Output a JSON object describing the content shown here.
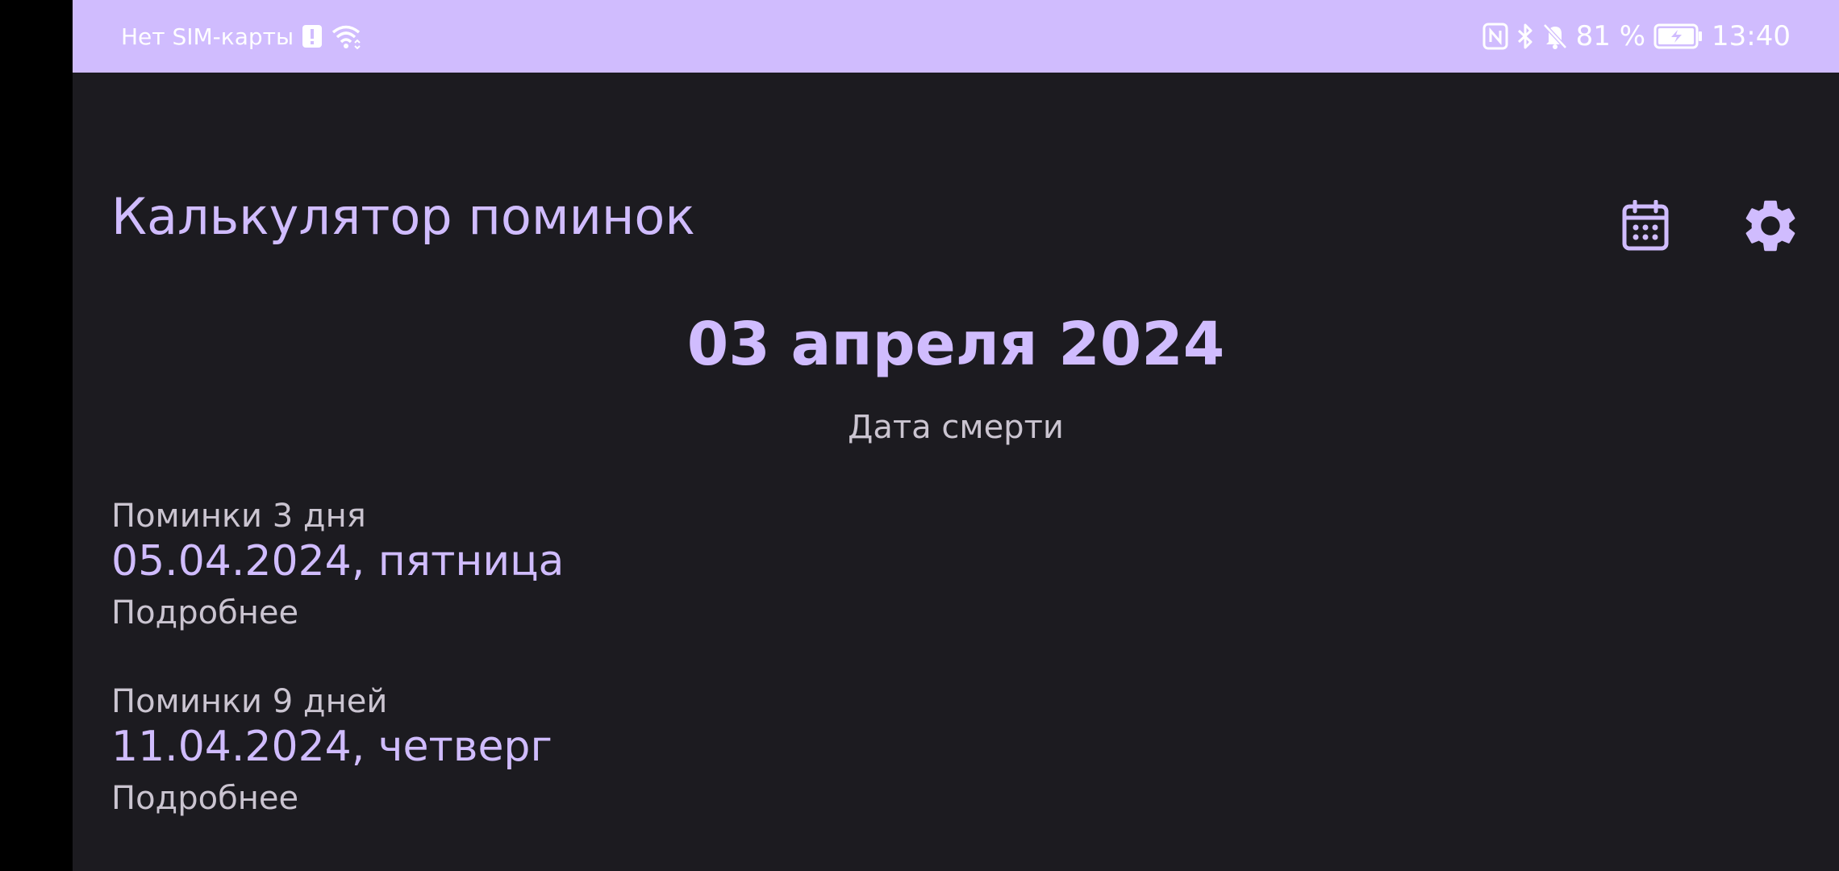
{
  "statusbar": {
    "carrier": "Нет SIM-карты",
    "battery_percent": "81 %",
    "time": "13:40",
    "icons": [
      "sim-alert-icon",
      "wifi-icon",
      "nfc-icon",
      "bluetooth-icon",
      "bell-off-icon",
      "battery-charging-icon"
    ]
  },
  "app": {
    "title": "Калькулятор поминок",
    "actions": [
      {
        "name": "calendar-button",
        "icon": "calendar-icon"
      },
      {
        "name": "settings-button",
        "icon": "gear-icon"
      }
    ],
    "accent_color": "#d0bcfe",
    "background_color": "#1c1b20"
  },
  "death": {
    "date": "03 апреля 2024",
    "label": "Дата смерти"
  },
  "memorials": [
    {
      "title": "Поминки 3 дня",
      "date": "05.04.2024, пятница",
      "more": "Подробнее"
    },
    {
      "title": "Поминки 9 дней",
      "date": "11.04.2024, четверг",
      "more": "Подробнее"
    }
  ]
}
